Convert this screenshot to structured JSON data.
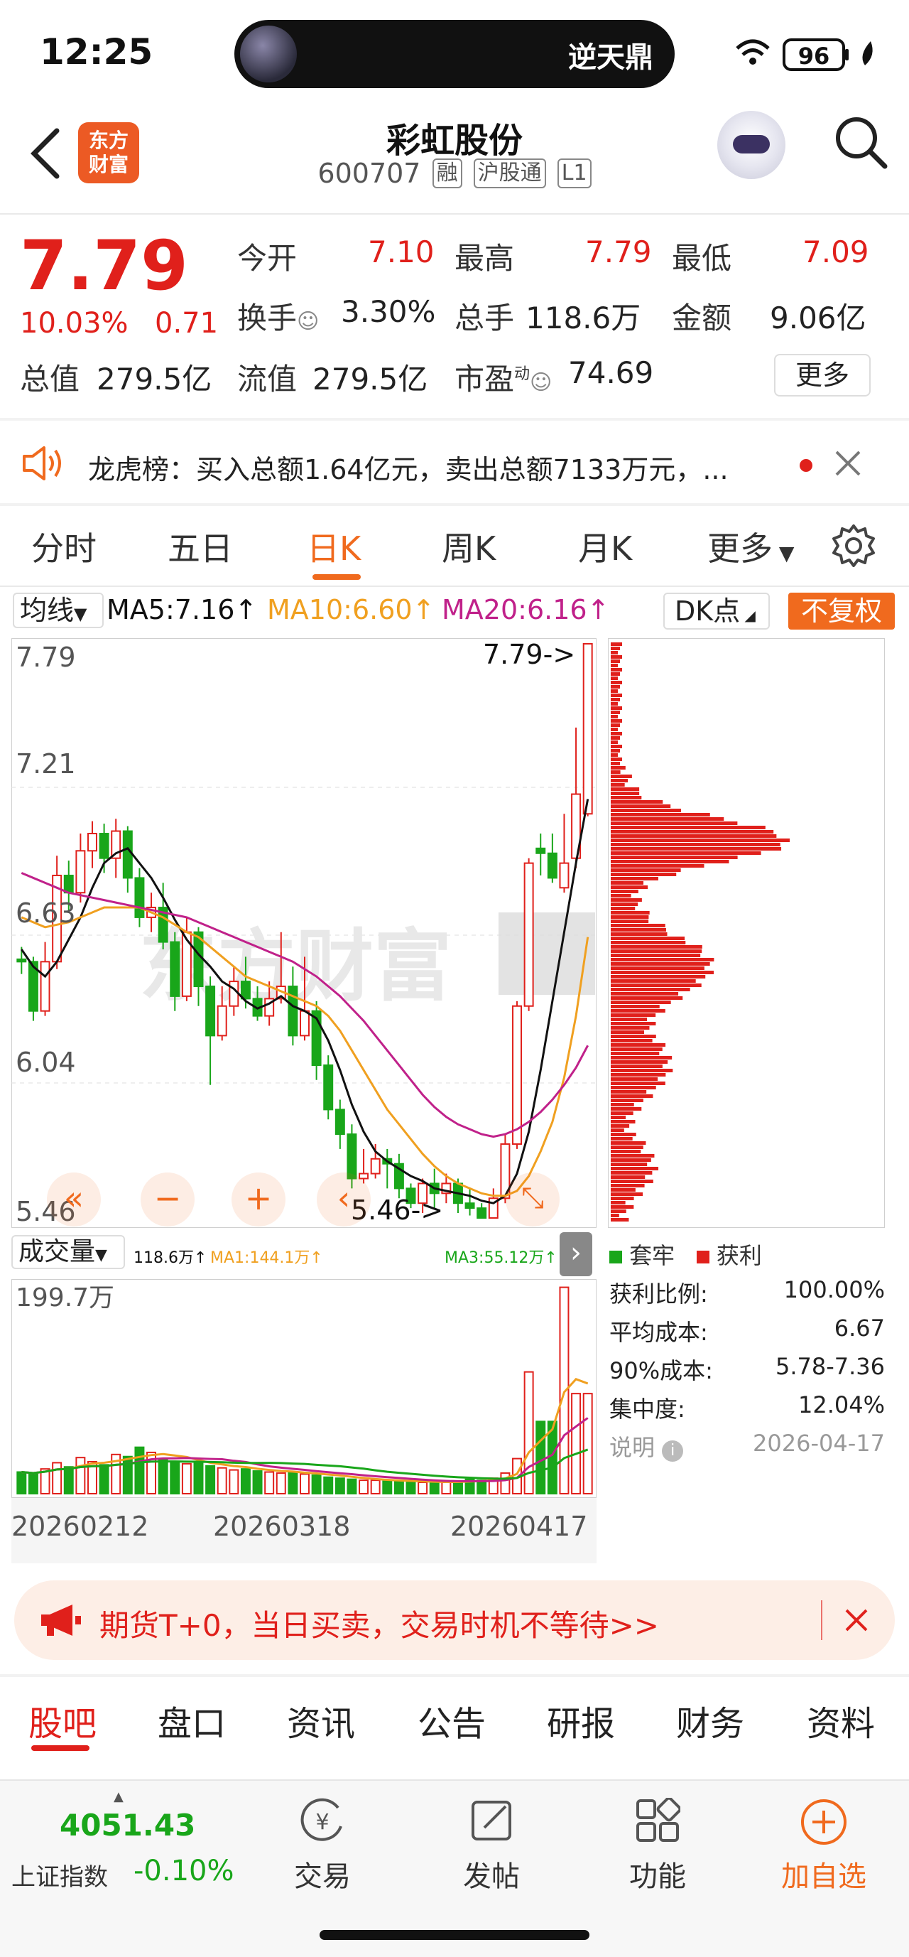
{
  "status_bar": {
    "time": "12:25",
    "island_title": "逆天鼎",
    "battery": "96"
  },
  "header": {
    "logo_text_line1": "东方",
    "logo_text_line2": "财富",
    "stock_name": "彩虹股份",
    "stock_code": "600707",
    "tags": [
      "融",
      "沪股通",
      "L1"
    ]
  },
  "quote": {
    "price": "7.79",
    "change_pct": "10.03%",
    "change_amt": "0.71",
    "open_label": "今开",
    "open_value": "7.10",
    "high_label": "最高",
    "high_value": "7.79",
    "low_label": "最低",
    "low_value": "7.09",
    "turnover_label": "换手",
    "turnover_value": "3.30%",
    "volume_label": "总手",
    "volume_value": "118.6万",
    "amount_label": "金额",
    "amount_value": "9.06亿",
    "mktcap_label": "总值",
    "mktcap_value": "279.5亿",
    "float_label": "流值",
    "float_value": "279.5亿",
    "pe_label": "市盈",
    "pe_sup": "动",
    "pe_value": "74.69",
    "more_label": "更多"
  },
  "notice": {
    "text": "龙虎榜：买入总额1.64亿元，卖出总额7133万元，..."
  },
  "period_tabs": [
    "分时",
    "五日",
    "日K",
    "周K",
    "月K",
    "更多"
  ],
  "active_period": "日K",
  "ma_row": {
    "selector": "均线",
    "ma5": "MA5:7.16↑",
    "ma10": "MA10:6.60↑",
    "ma20": "MA20:6.16↑",
    "dk": "DK点",
    "fq": "不复权"
  },
  "colors": {
    "up": "#e0201b",
    "down": "#19a61a",
    "ma5": "#111111",
    "ma10": "#f0a020",
    "ma20": "#c0218a",
    "accent": "#f06a1e"
  },
  "kline": {
    "y_labels": [
      "7.79",
      "7.21",
      "6.63",
      "6.04",
      "5.46"
    ],
    "max_marker": "7.79->",
    "min_marker": "5.46->",
    "watermark": "东方财富"
  },
  "volume_panel": {
    "selector": "成交量",
    "vol": "118.6万↑",
    "ma1": "MA1:144.1万↑",
    "ma3": "MA3:55.12万↑",
    "max_label": "199.7万",
    "dates": [
      "20260212",
      "20260318",
      "20260417"
    ]
  },
  "chip": {
    "legend_trapped": "套牢",
    "legend_profit": "获利",
    "rows": [
      {
        "label": "获利比例:",
        "value": "100.00%"
      },
      {
        "label": "平均成本:",
        "value": "6.67"
      },
      {
        "label": "90%成本:",
        "value": "5.78-7.36"
      },
      {
        "label": "集中度:",
        "value": "12.04%"
      }
    ],
    "note_label": "说明",
    "date": "2026-04-17"
  },
  "banner": {
    "text": "期货T+0，当日买卖，交易时机不等待>>"
  },
  "sub_tabs": [
    "股吧",
    "盘口",
    "资讯",
    "公告",
    "研报",
    "财务",
    "资料"
  ],
  "bottom": {
    "index_value": "4051.43",
    "index_name": "上证指数",
    "index_change": "-0.10%",
    "nav": [
      "交易",
      "发帖",
      "功能",
      "加自选"
    ]
  },
  "chart_data": {
    "type": "candlestick",
    "title": "",
    "ylim": [
      5.46,
      7.79
    ],
    "y_ticks": [
      7.79,
      7.21,
      6.63,
      6.04,
      5.46
    ],
    "x_ticks": [
      "20260212",
      "20260318",
      "20260417"
    ],
    "candles": [
      {
        "o": 6.51,
        "c": 6.5,
        "h": 6.56,
        "l": 6.45
      },
      {
        "o": 6.5,
        "c": 6.3,
        "h": 6.52,
        "l": 6.26
      },
      {
        "o": 6.3,
        "c": 6.5,
        "h": 6.58,
        "l": 6.28
      },
      {
        "o": 6.5,
        "c": 6.85,
        "h": 6.93,
        "l": 6.47
      },
      {
        "o": 6.85,
        "c": 6.78,
        "h": 6.91,
        "l": 6.7
      },
      {
        "o": 6.78,
        "c": 6.95,
        "h": 7.02,
        "l": 6.74
      },
      {
        "o": 6.95,
        "c": 7.02,
        "h": 7.07,
        "l": 6.88
      },
      {
        "o": 7.02,
        "c": 6.92,
        "h": 7.06,
        "l": 6.86
      },
      {
        "o": 6.92,
        "c": 7.03,
        "h": 7.08,
        "l": 6.84
      },
      {
        "o": 7.03,
        "c": 6.84,
        "h": 7.05,
        "l": 6.78
      },
      {
        "o": 6.84,
        "c": 6.68,
        "h": 6.88,
        "l": 6.64
      },
      {
        "o": 6.68,
        "c": 6.72,
        "h": 6.78,
        "l": 6.62
      },
      {
        "o": 6.72,
        "c": 6.58,
        "h": 6.82,
        "l": 6.55
      },
      {
        "o": 6.58,
        "c": 6.36,
        "h": 6.62,
        "l": 6.3
      },
      {
        "o": 6.36,
        "c": 6.62,
        "h": 6.68,
        "l": 6.34
      },
      {
        "o": 6.62,
        "c": 6.4,
        "h": 6.64,
        "l": 6.32
      },
      {
        "o": 6.4,
        "c": 6.2,
        "h": 6.44,
        "l": 6.0
      },
      {
        "o": 6.2,
        "c": 6.32,
        "h": 6.4,
        "l": 6.18
      },
      {
        "o": 6.32,
        "c": 6.42,
        "h": 6.48,
        "l": 6.28
      },
      {
        "o": 6.42,
        "c": 6.35,
        "h": 6.52,
        "l": 6.31
      },
      {
        "o": 6.35,
        "c": 6.28,
        "h": 6.4,
        "l": 6.26
      },
      {
        "o": 6.28,
        "c": 6.35,
        "h": 6.42,
        "l": 6.24
      },
      {
        "o": 6.35,
        "c": 6.4,
        "h": 6.62,
        "l": 6.33
      },
      {
        "o": 6.4,
        "c": 6.2,
        "h": 6.48,
        "l": 6.16
      },
      {
        "o": 6.2,
        "c": 6.3,
        "h": 6.52,
        "l": 6.18
      },
      {
        "o": 6.3,
        "c": 6.08,
        "h": 6.34,
        "l": 6.02
      },
      {
        "o": 6.08,
        "c": 5.9,
        "h": 6.12,
        "l": 5.86
      },
      {
        "o": 5.9,
        "c": 5.8,
        "h": 5.94,
        "l": 5.74
      },
      {
        "o": 5.8,
        "c": 5.62,
        "h": 5.84,
        "l": 5.58
      },
      {
        "o": 5.62,
        "c": 5.64,
        "h": 5.74,
        "l": 5.6
      },
      {
        "o": 5.64,
        "c": 5.7,
        "h": 5.76,
        "l": 5.62
      },
      {
        "o": 5.7,
        "c": 5.68,
        "h": 5.74,
        "l": 5.58
      },
      {
        "o": 5.68,
        "c": 5.58,
        "h": 5.72,
        "l": 5.54
      },
      {
        "o": 5.58,
        "c": 5.52,
        "h": 5.6,
        "l": 5.5
      },
      {
        "o": 5.52,
        "c": 5.6,
        "h": 5.62,
        "l": 5.48
      },
      {
        "o": 5.6,
        "c": 5.56,
        "h": 5.66,
        "l": 5.5
      },
      {
        "o": 5.56,
        "c": 5.6,
        "h": 5.64,
        "l": 5.52
      },
      {
        "o": 5.6,
        "c": 5.52,
        "h": 5.62,
        "l": 5.48
      },
      {
        "o": 5.52,
        "c": 5.5,
        "h": 5.58,
        "l": 5.47
      },
      {
        "o": 5.5,
        "c": 5.46,
        "h": 5.52,
        "l": 5.46
      },
      {
        "o": 5.46,
        "c": 5.54,
        "h": 5.58,
        "l": 5.46
      },
      {
        "o": 5.54,
        "c": 5.76,
        "h": 5.8,
        "l": 5.52
      },
      {
        "o": 5.76,
        "c": 6.32,
        "h": 6.34,
        "l": 5.74
      },
      {
        "o": 6.32,
        "c": 6.9,
        "h": 6.92,
        "l": 6.3
      },
      {
        "o": 6.96,
        "c": 6.94,
        "h": 7.02,
        "l": 6.85
      },
      {
        "o": 6.94,
        "c": 6.84,
        "h": 7.02,
        "l": 6.82
      },
      {
        "o": 6.8,
        "c": 6.9,
        "h": 7.1,
        "l": 6.78
      },
      {
        "o": 6.92,
        "c": 7.18,
        "h": 7.45,
        "l": 6.88
      },
      {
        "o": 7.1,
        "c": 7.79,
        "h": 7.79,
        "l": 7.09
      }
    ],
    "ma5": [
      6.55,
      6.48,
      6.44,
      6.5,
      6.59,
      6.68,
      6.8,
      6.9,
      6.94,
      6.96,
      6.9,
      6.84,
      6.76,
      6.67,
      6.59,
      6.53,
      6.48,
      6.42,
      6.39,
      6.34,
      6.31,
      6.33,
      6.36,
      6.32,
      6.3,
      6.27,
      6.18,
      6.06,
      5.92,
      5.81,
      5.73,
      5.69,
      5.66,
      5.63,
      5.61,
      5.58,
      5.57,
      5.56,
      5.55,
      5.53,
      5.52,
      5.55,
      5.64,
      5.81,
      6.06,
      6.34,
      6.62,
      6.9,
      7.16
    ],
    "ma10": [
      6.68,
      6.66,
      6.64,
      6.65,
      6.66,
      6.68,
      6.7,
      6.72,
      6.72,
      6.72,
      6.72,
      6.7,
      6.68,
      6.65,
      6.62,
      6.6,
      6.56,
      6.52,
      6.48,
      6.44,
      6.42,
      6.4,
      6.38,
      6.36,
      6.34,
      6.32,
      6.28,
      6.22,
      6.14,
      6.06,
      5.98,
      5.9,
      5.84,
      5.78,
      5.72,
      5.67,
      5.63,
      5.6,
      5.58,
      5.56,
      5.55,
      5.55,
      5.57,
      5.63,
      5.73,
      5.85,
      6.03,
      6.28,
      6.6
    ],
    "ma20": [
      6.86,
      6.84,
      6.82,
      6.8,
      6.78,
      6.77,
      6.76,
      6.75,
      6.74,
      6.73,
      6.72,
      6.71,
      6.7,
      6.69,
      6.68,
      6.66,
      6.64,
      6.62,
      6.6,
      6.58,
      6.56,
      6.54,
      6.52,
      6.5,
      6.47,
      6.44,
      6.4,
      6.36,
      6.31,
      6.26,
      6.2,
      6.14,
      6.08,
      6.02,
      5.96,
      5.91,
      5.87,
      5.84,
      5.82,
      5.8,
      5.79,
      5.8,
      5.82,
      5.85,
      5.89,
      5.94,
      6.0,
      6.07,
      6.16
    ],
    "volumes": [
      21,
      19,
      24,
      30,
      26,
      35,
      31,
      28,
      38,
      36,
      45,
      40,
      33,
      31,
      29,
      30,
      27,
      25,
      23,
      24,
      22,
      21,
      20,
      20,
      19,
      18,
      16,
      15,
      14,
      13,
      13,
      12,
      12,
      12,
      11,
      11,
      11,
      12,
      14,
      13,
      15,
      20,
      34,
      118,
      70,
      70,
      200,
      97,
      97
    ],
    "volume_unit": "万",
    "volume_max": 199.7,
    "chip_distribution": {
      "profit_ratio": "100.00%",
      "avg_cost": 6.67,
      "cost_90": "5.78-7.36",
      "concentration": "12.04%"
    }
  }
}
